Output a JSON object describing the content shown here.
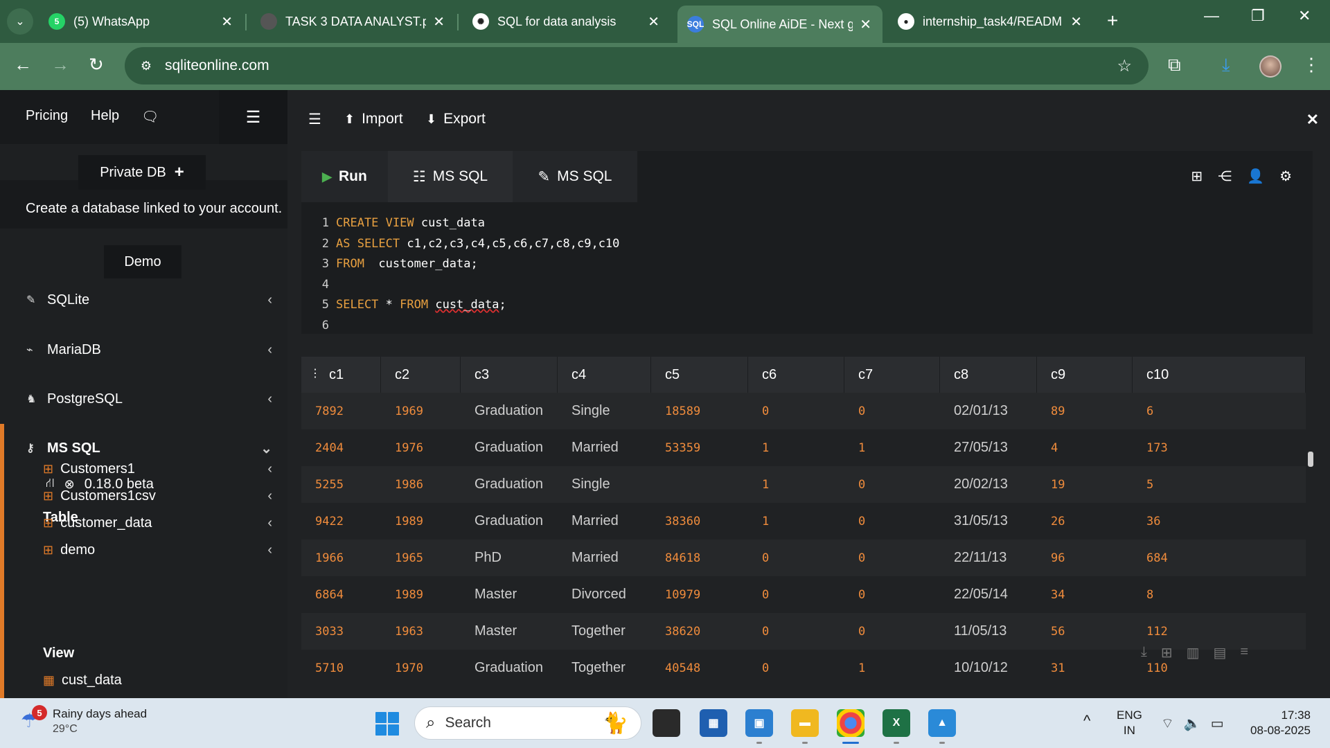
{
  "browser": {
    "tabs": [
      {
        "title": "(5) WhatsApp",
        "icon": "whatsapp-icon",
        "badge": "5"
      },
      {
        "title": "TASK 3 DATA ANALYST.p",
        "icon": "pdf-icon"
      },
      {
        "title": "SQL for data analysis",
        "icon": "chatgpt-icon"
      },
      {
        "title": "SQL Online AiDE - Next g",
        "icon": "sql-icon",
        "fav_text": "SQL",
        "active": true
      },
      {
        "title": "internship_task4/READM",
        "icon": "github-icon"
      }
    ],
    "url": "sqliteonline.com"
  },
  "sidebar": {
    "links": {
      "pricing": "Pricing",
      "help": "Help"
    },
    "private_db": "Private DB",
    "private_db_plus": "+",
    "description": "Create a database linked to your account.",
    "demo": "Demo",
    "engines": [
      {
        "label": "SQLite",
        "icon": "feather-icon"
      },
      {
        "label": "MariaDB",
        "icon": "seal-icon"
      },
      {
        "label": "PostgreSQL",
        "icon": "elephant-icon"
      },
      {
        "label": "MS SQL",
        "icon": "mssql-icon",
        "expanded": true
      }
    ],
    "version": "0.18.0 beta",
    "table_heading": "Table",
    "tables": [
      "Customers1",
      "Customers1csv",
      "customer_data",
      "demo"
    ],
    "view_heading": "View",
    "views": [
      "cust_data"
    ]
  },
  "toolbar": {
    "import": "Import",
    "export": "Export"
  },
  "editor": {
    "run": "Run",
    "tab_active": "MS SQL",
    "tab_edit": "MS SQL",
    "lines": [
      {
        "n": "1",
        "parts": [
          {
            "t": "CREATE VIEW",
            "kw": true
          },
          {
            "t": " cust_data"
          }
        ]
      },
      {
        "n": "2",
        "parts": [
          {
            "t": "AS SELECT",
            "kw": true
          },
          {
            "t": " c1,c2,c3,c4,c5,c6,c7,c8,c9,c10"
          }
        ]
      },
      {
        "n": "3",
        "parts": [
          {
            "t": "FROM",
            "kw": true
          },
          {
            "t": "  customer_data;"
          }
        ]
      },
      {
        "n": "4",
        "parts": []
      },
      {
        "n": "5",
        "parts": [
          {
            "t": "SELECT",
            "kw": true
          },
          {
            "t": " * "
          },
          {
            "t": "FROM",
            "kw": true
          },
          {
            "t": " "
          },
          {
            "t": "cust_data",
            "squig": true
          },
          {
            "t": ";"
          }
        ]
      },
      {
        "n": "6",
        "parts": []
      }
    ]
  },
  "results": {
    "columns": [
      "c1",
      "c2",
      "c3",
      "c4",
      "c5",
      "c6",
      "c7",
      "c8",
      "c9",
      "c10"
    ],
    "rows": [
      [
        "7892",
        "1969",
        "Graduation",
        "Single",
        "18589",
        "0",
        "0",
        "02/01/13",
        "89",
        "6"
      ],
      [
        "2404",
        "1976",
        "Graduation",
        "Married",
        "53359",
        "1",
        "1",
        "27/05/13",
        "4",
        "173"
      ],
      [
        "5255",
        "1986",
        "Graduation",
        "Single",
        "",
        "1",
        "0",
        "20/02/13",
        "19",
        "5"
      ],
      [
        "9422",
        "1989",
        "Graduation",
        "Married",
        "38360",
        "1",
        "0",
        "31/05/13",
        "26",
        "36"
      ],
      [
        "1966",
        "1965",
        "PhD",
        "Married",
        "84618",
        "0",
        "0",
        "22/11/13",
        "96",
        "684"
      ],
      [
        "6864",
        "1989",
        "Master",
        "Divorced",
        "10979",
        "0",
        "0",
        "22/05/14",
        "34",
        "8"
      ],
      [
        "3033",
        "1963",
        "Master",
        "Together",
        "38620",
        "0",
        "0",
        "11/05/13",
        "56",
        "112"
      ],
      [
        "5710",
        "1970",
        "Graduation",
        "Together",
        "40548",
        "0",
        "1",
        "10/10/12",
        "31",
        "110"
      ]
    ]
  },
  "taskbar": {
    "weather_title": "Rainy days ahead",
    "weather_temp": "29°C",
    "weather_badge": "5",
    "search": "Search",
    "lang1": "ENG",
    "lang2": "IN",
    "time": "17:38",
    "date": "08-08-2025"
  },
  "colors": {
    "accent": "#e07a28",
    "browser_frame": "#2f5b40",
    "number_text": "#f08c3c",
    "keyword": "#e8a040"
  }
}
